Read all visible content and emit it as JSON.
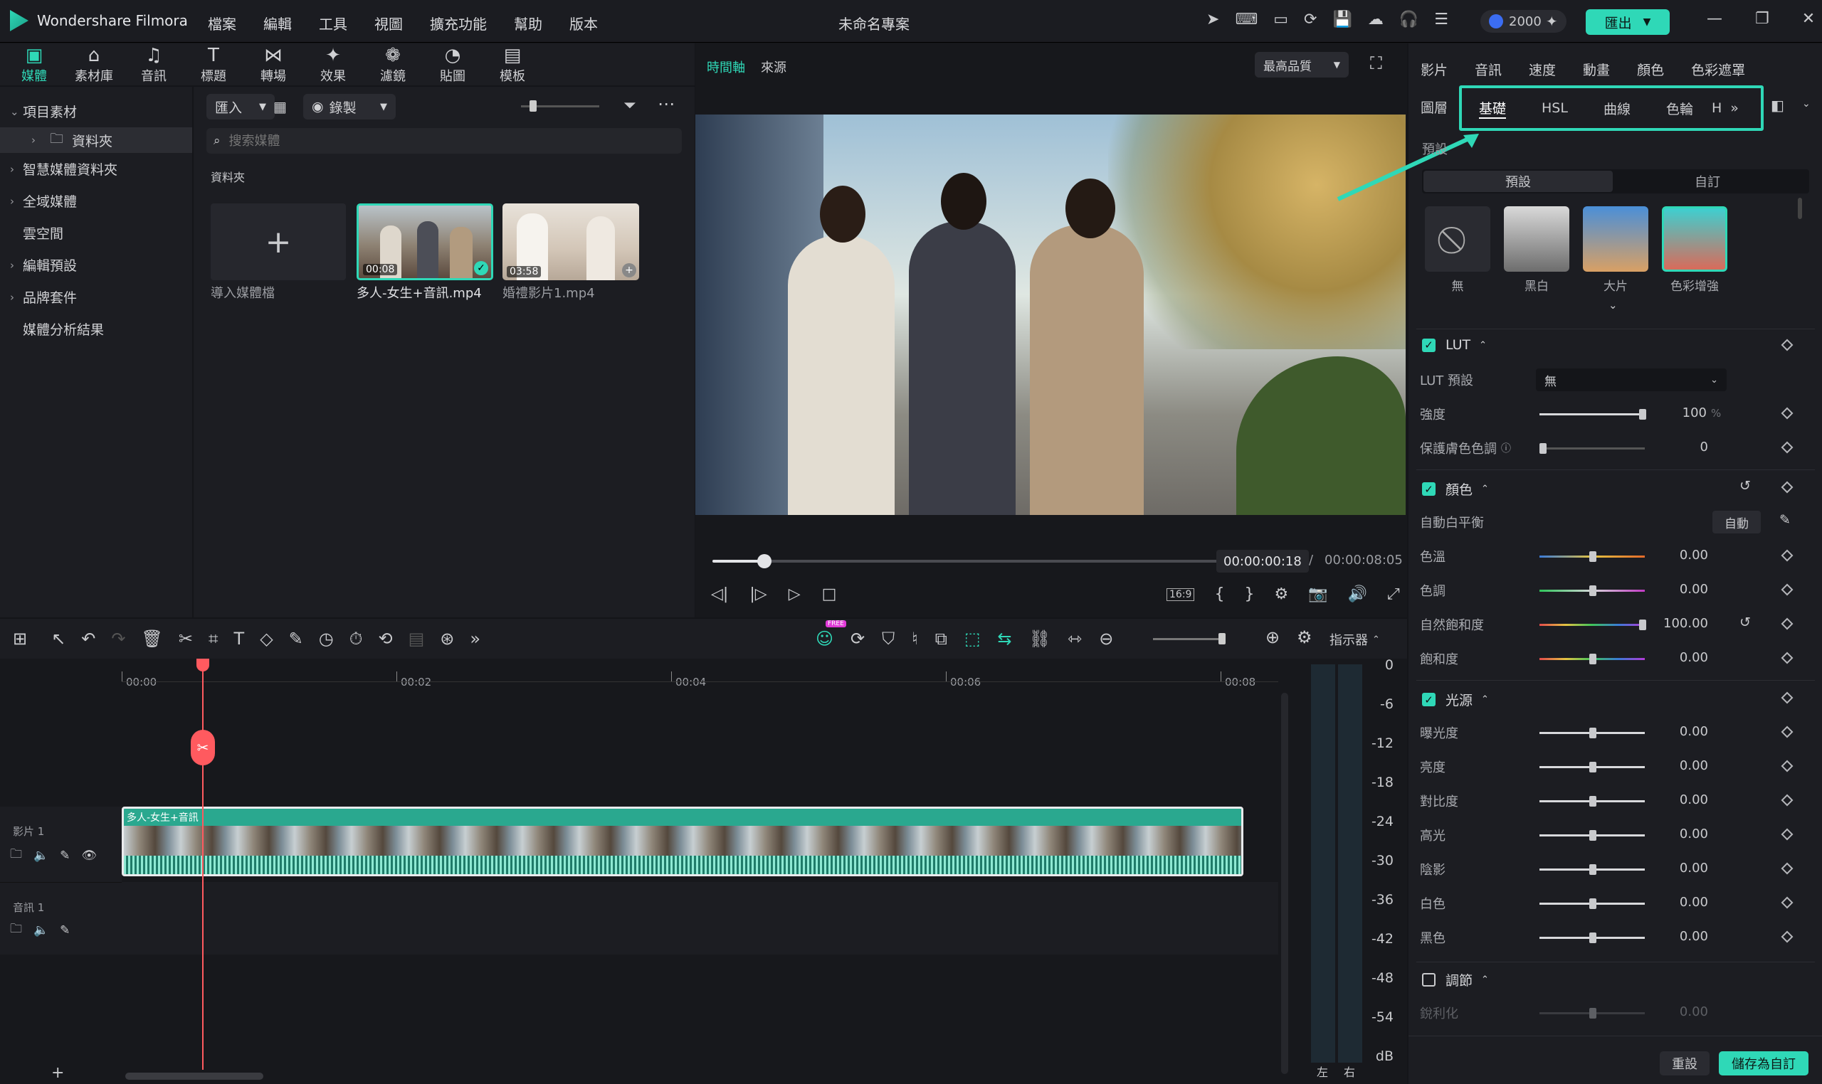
{
  "app": {
    "name": "Wondershare Filmora",
    "project_title": "未命名專案",
    "credits": "2000",
    "export_label": "匯出"
  },
  "menu": [
    "檔案",
    "編輯",
    "工具",
    "視圖",
    "擴充功能",
    "幫助",
    "版本"
  ],
  "toolbar": [
    {
      "label": "媒體",
      "icon": "folder-icon"
    },
    {
      "label": "素材庫",
      "icon": "store-icon"
    },
    {
      "label": "音訊",
      "icon": "music-icon"
    },
    {
      "label": "標題",
      "icon": "text-icon"
    },
    {
      "label": "轉場",
      "icon": "transition-icon"
    },
    {
      "label": "效果",
      "icon": "effects-icon"
    },
    {
      "label": "濾鏡",
      "icon": "filter-icon"
    },
    {
      "label": "貼圖",
      "icon": "sticker-icon"
    },
    {
      "label": "模板",
      "icon": "template-icon"
    }
  ],
  "sidebar": {
    "items": [
      {
        "label": "項目素材",
        "expanded": true
      },
      {
        "label": "資料夾",
        "selected": true
      },
      {
        "label": "智慧媒體資料夾"
      },
      {
        "label": "全域媒體"
      },
      {
        "label": "雲空間"
      },
      {
        "label": "編輯預設"
      },
      {
        "label": "品牌套件"
      },
      {
        "label": "媒體分析結果"
      }
    ]
  },
  "media": {
    "import_label": "匯入",
    "record_label": "錄製",
    "search_placeholder": "搜索媒體",
    "folder_label": "資料夾",
    "import_tile_label": "導入媒體檔",
    "clips": [
      {
        "name": "多人-女生+音訊.mp4",
        "duration": "00:08",
        "selected": true
      },
      {
        "name": "婚禮影片1.mp4",
        "duration": "03:58"
      }
    ]
  },
  "preview": {
    "tabs": [
      "時間軸",
      "來源"
    ],
    "quality": "最高品質",
    "current_time": "00:00:00:18",
    "total_time": "00:00:08:05",
    "progress": 0.1,
    "aspect": "16:9"
  },
  "right_panel": {
    "tabs": [
      "影片",
      "音訊",
      "速度",
      "動畫",
      "顏色",
      "色彩遮罩"
    ],
    "active_tab": "色彩遮罩",
    "layer_label": "圖層",
    "subtabs": [
      "基礎",
      "HSL",
      "曲線",
      "色輪",
      "H"
    ],
    "preset_label": "預設",
    "preset_toggle": [
      "預設",
      "自訂"
    ],
    "presets": [
      {
        "label": "無"
      },
      {
        "label": "黑白"
      },
      {
        "label": "大片"
      },
      {
        "label": "色彩增強"
      }
    ],
    "lut": {
      "title": "LUT",
      "preset_label": "LUT 預設",
      "preset_value": "無",
      "strength_label": "強度",
      "strength_value": "100",
      "strength_unit": "%",
      "skin_label": "保護膚色色調",
      "skin_value": "0"
    },
    "color": {
      "title": "顏色",
      "awb_label": "自動白平衡",
      "awb_button": "自動",
      "rows": [
        {
          "label": "色溫",
          "value": "0.00"
        },
        {
          "label": "色調",
          "value": "0.00"
        },
        {
          "label": "自然飽和度",
          "value": "100.00"
        },
        {
          "label": "飽和度",
          "value": "0.00"
        }
      ]
    },
    "light": {
      "title": "光源",
      "rows": [
        {
          "label": "曝光度",
          "value": "0.00"
        },
        {
          "label": "亮度",
          "value": "0.00"
        },
        {
          "label": "對比度",
          "value": "0.00"
        },
        {
          "label": "高光",
          "value": "0.00"
        },
        {
          "label": "陰影",
          "value": "0.00"
        },
        {
          "label": "白色",
          "value": "0.00"
        },
        {
          "label": "黑色",
          "value": "0.00"
        }
      ]
    },
    "adjust": {
      "title": "調節",
      "sharpen_label": "銳利化",
      "sharpen_value": "0.00"
    },
    "reset_label": "重設",
    "save_label": "儲存為自訂"
  },
  "timeline": {
    "indicator_label": "指示器",
    "free_badge": "FREE",
    "ruler": [
      "00:00",
      "00:02",
      "00:04",
      "00:06",
      "00:08"
    ],
    "tracks": [
      {
        "label": "影片 1",
        "clip": "多人-女生+音訊"
      },
      {
        "label": "音訊 1"
      }
    ],
    "db_scale": [
      "0",
      "-6",
      "-12",
      "-18",
      "-24",
      "-30",
      "-36",
      "-42",
      "-48",
      "-54",
      "dB"
    ],
    "channels": [
      "左",
      "右"
    ]
  },
  "colors": {
    "accent": "#2fd8b7",
    "playhead": "#ff5a5f"
  }
}
